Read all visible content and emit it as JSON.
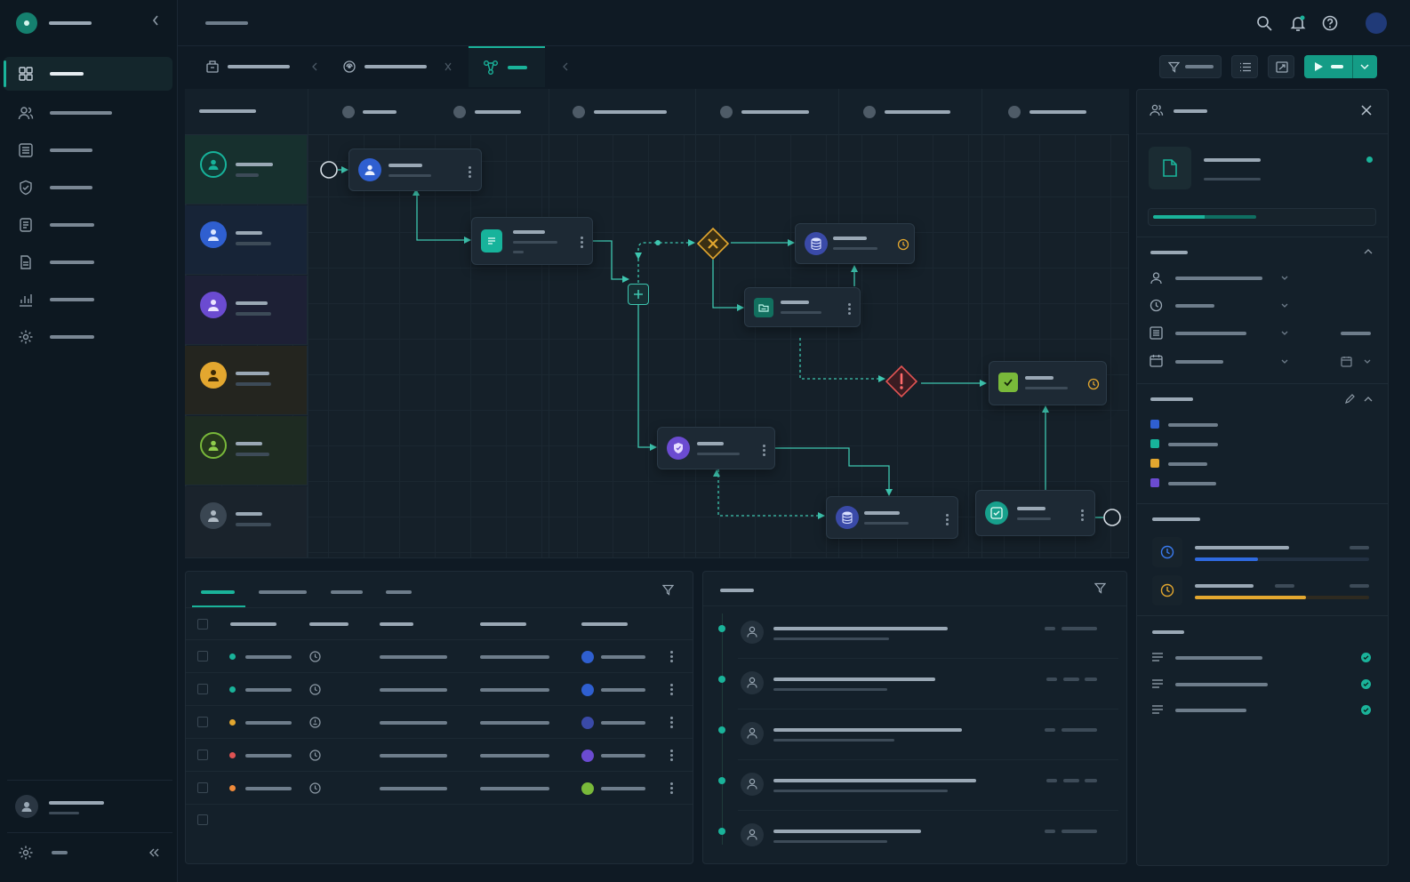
{
  "colors": {
    "accent": "#1ab39a",
    "bg": "#0f1a24",
    "panel": "#14202a",
    "node": "#1d2934",
    "blue": "#2f5fd0",
    "teal": "#17b39b",
    "purple": "#6b4bd1",
    "amber": "#e3a72f",
    "green": "#79b93a",
    "red": "#e05353",
    "orange": "#ef8a3a",
    "gray": "#6b7884"
  },
  "icons": {
    "sidebar": [
      "grid-icon",
      "users-icon",
      "list-icon",
      "shield-icon",
      "document-icon",
      "file-icon",
      "chart-icon",
      "gear-icon"
    ],
    "topbar": [
      "search-icon",
      "bell-icon",
      "help-icon"
    ],
    "lanes": [
      "user-teal-icon",
      "user-blue-icon",
      "user-purple-icon",
      "user-amber-icon",
      "user-green-icon",
      "user-gray-icon"
    ],
    "panel": [
      "document-icon",
      "user-icon",
      "clock-icon",
      "list-icon",
      "calendar-icon"
    ]
  },
  "progress": {
    "panel_header": 0.43,
    "task_blue": 0.36,
    "task_amber": 0.64
  },
  "task_row_status_colors": [
    "#1ab39a",
    "#1ab39a",
    "#e3a72f",
    "#e05353",
    "#ef8a3a"
  ],
  "legend_colors": [
    "#2f5fd0",
    "#17b39b",
    "#e3a72f",
    "#6b4bd1"
  ]
}
